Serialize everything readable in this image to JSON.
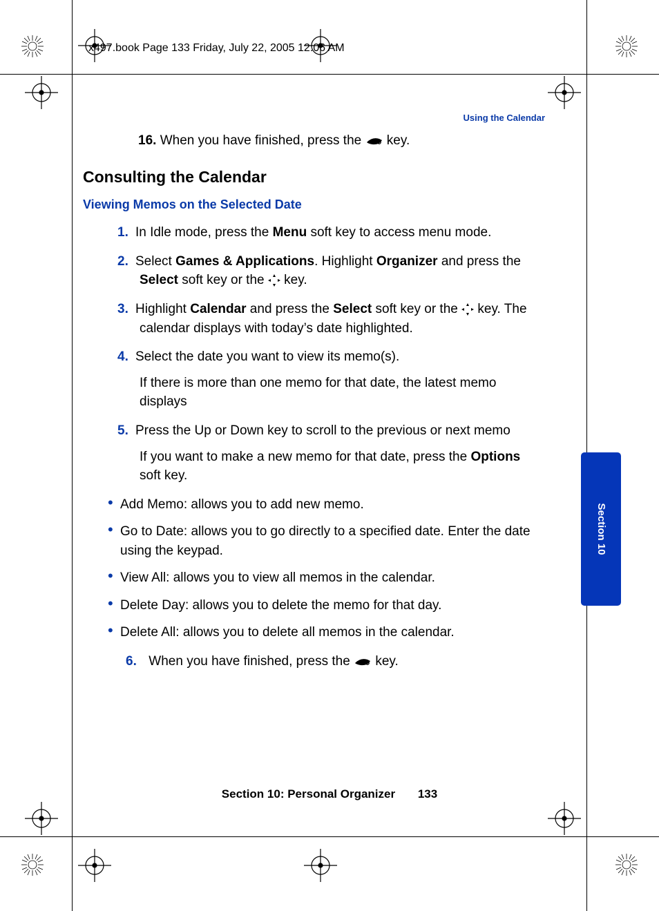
{
  "meta": "x497.book  Page 133  Friday, July 22, 2005  12:06 AM",
  "header_right": "Using the Calendar",
  "pre": {
    "num": "16.",
    "text_before": "When you have finished, press the ",
    "text_after": " key."
  },
  "title": "Consulting the Calendar",
  "subhead": "Viewing Memos on the Selected Date",
  "steps": [
    {
      "n": "1.",
      "parts": [
        "In Idle mode, press the ",
        {
          "b": "Menu"
        },
        " soft key to access menu mode."
      ]
    },
    {
      "n": "2.",
      "parts": [
        "Select ",
        {
          "b": "Games & Applications"
        },
        ". Highlight ",
        {
          "b": "Organizer"
        },
        " and press the ",
        {
          "b": "Select"
        },
        " soft key or the ",
        {
          "icon": "four"
        },
        " key."
      ]
    },
    {
      "n": "3.",
      "parts": [
        "Highlight ",
        {
          "b": "Calendar"
        },
        " and press the ",
        {
          "b": "Select"
        },
        " soft key or the ",
        {
          "icon": "four"
        },
        " key. The calendar displays with today’s date highlighted."
      ]
    },
    {
      "n": "4.",
      "parts": [
        "Select the date you want to view its memo(s)."
      ],
      "sub": [
        "If there is more than one memo for that date, the latest memo displays"
      ]
    },
    {
      "n": "5.",
      "parts": [
        "Press the Up or Down key to scroll to the previous or next memo"
      ],
      "sub": [
        "If you want to make a new memo for that date, press the ",
        {
          "b": "Options"
        },
        " soft key."
      ]
    }
  ],
  "bullets": [
    "Add Memo: allows you to add new memo.",
    "Go to Date: allows you to go directly to a specified date. Enter the date using the keypad.",
    "View All: allows you to view all memos in the calendar.",
    "Delete Day: allows you to delete the memo for that day.",
    "Delete All: allows you to delete all memos in the calendar."
  ],
  "step6": {
    "n": "6.",
    "before": "When you have finished, press the ",
    "after": " key."
  },
  "footer": {
    "label": "Section 10: Personal Organizer",
    "page": "133"
  },
  "tab": "Section 10"
}
